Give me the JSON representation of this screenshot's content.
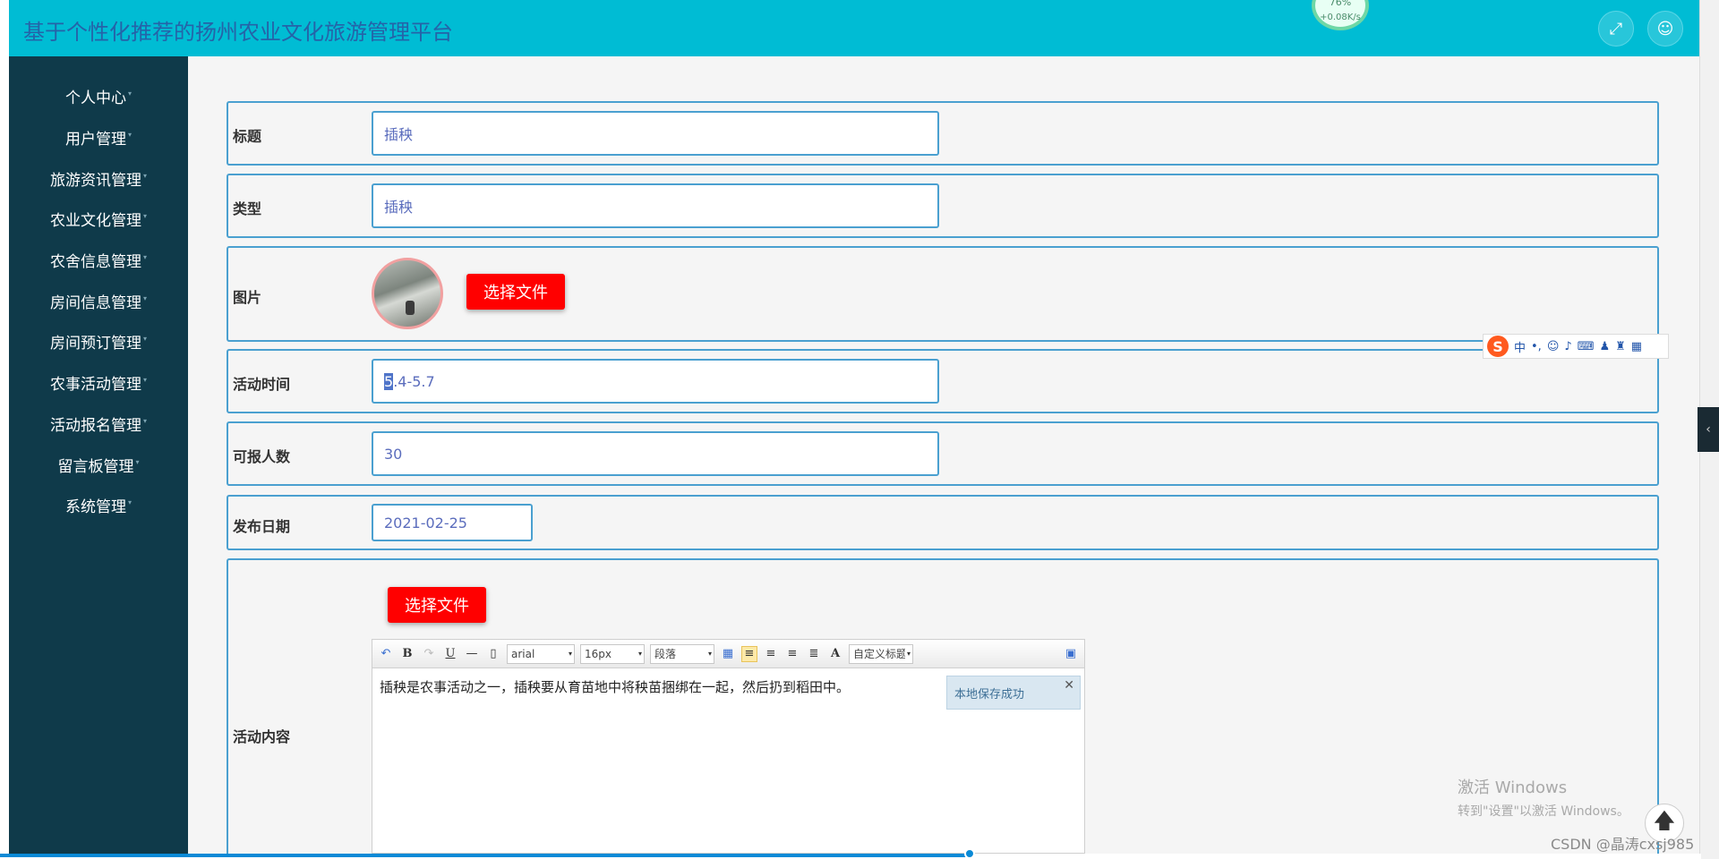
{
  "header": {
    "title": "基于个性化推荐的扬州农业文化旅游管理平台",
    "net_speed": "+0.08K/s",
    "net_percent": "76%"
  },
  "sidebar": {
    "items": [
      {
        "label": "个人中心"
      },
      {
        "label": "用户管理"
      },
      {
        "label": "旅游资讯管理"
      },
      {
        "label": "农业文化管理"
      },
      {
        "label": "农舍信息管理"
      },
      {
        "label": "房间信息管理"
      },
      {
        "label": "房间预订管理"
      },
      {
        "label": "农事活动管理"
      },
      {
        "label": "活动报名管理"
      },
      {
        "label": "留言板管理"
      },
      {
        "label": "系统管理"
      }
    ]
  },
  "form": {
    "title_label": "标题",
    "title_value": "插秧",
    "type_label": "类型",
    "type_value": "插秧",
    "image_label": "图片",
    "choose_file_label": "选择文件",
    "activity_time_label": "活动时间",
    "activity_time_value_sel": "5",
    "activity_time_value_rest": ".4-5.7",
    "capacity_label": "可报人数",
    "capacity_value": "30",
    "publish_date_label": "发布日期",
    "publish_date_value": "2021-02-25",
    "content_label": "活动内容",
    "content_choose_file_label": "选择文件"
  },
  "editor": {
    "font_family": "arial",
    "font_size": "16px",
    "paragraph": "段落",
    "custom_title": "自定义标题",
    "content": "插秧是农事活动之一，插秧要从育苗地中将秧苗捆绑在一起，然后扔到稻田中。",
    "toast": "本地保存成功"
  },
  "ime": {
    "mode": "中"
  },
  "watermark": {
    "line1": "激活 Windows",
    "line2": "转到\"设置\"以激活 Windows。"
  },
  "csdn": "CSDN @晶涛cxsj985",
  "scroll": {
    "horizontal_progress": 0.57
  },
  "colors": {
    "header_bg": "#00bcd4",
    "sidebar_bg": "#0f3a4a",
    "accent_border": "#4aa0d0",
    "button_red": "#ff0000"
  }
}
